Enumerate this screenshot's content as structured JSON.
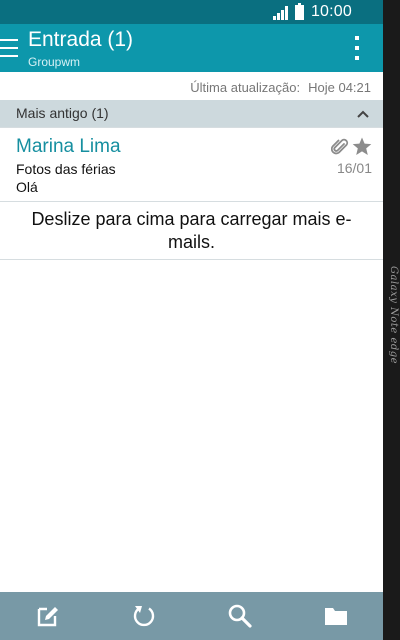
{
  "status_bar": {
    "time": "10:00",
    "icons": [
      "signal-icon",
      "battery-icon"
    ]
  },
  "app_bar": {
    "title": "Entrada (1)",
    "subtitle": "Groupwm",
    "left_icon": "menu-icon",
    "right_icon": "more-options-icon"
  },
  "last_update": {
    "label": "Última atualização:",
    "value": "Hoje 04:21"
  },
  "group_header": {
    "label": "Mais antigo (1)",
    "icon": "chevron-up-icon"
  },
  "email": {
    "sender": "Marina Lima",
    "subject": "Fotos das férias",
    "preview": "Olá",
    "date": "16/01",
    "icons": [
      "attachment-icon",
      "star-icon"
    ]
  },
  "load_more": {
    "text": "Deslize para cima para carregar mais e-mails."
  },
  "bottom_bar": {
    "buttons": [
      "compose-icon",
      "refresh-icon",
      "search-icon",
      "folder-icon"
    ]
  },
  "device": {
    "edge_label": "Galaxy Note edge"
  },
  "colors": {
    "status_bar": "#0a6f80",
    "app_bar": "#0d97ab",
    "group_header": "#cdd9dd",
    "sender": "#168fa0",
    "bottom_bar": "#7899a6"
  }
}
